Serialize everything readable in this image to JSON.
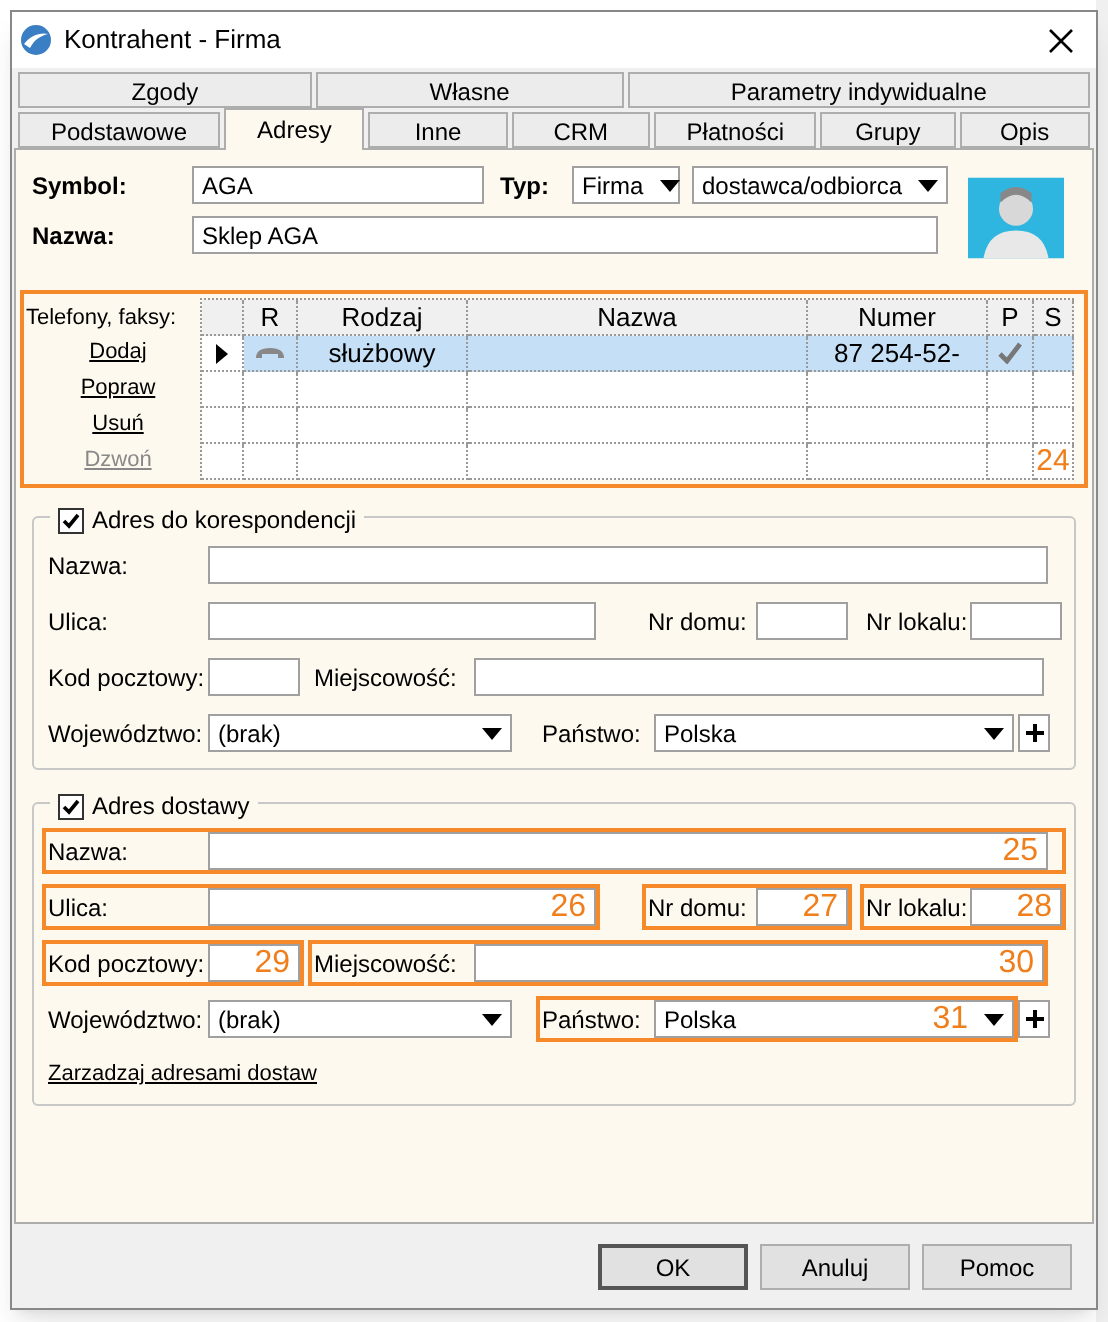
{
  "window": {
    "title": "Kontrahent - Firma"
  },
  "tabs_row_1": [
    {
      "label": "Zgody",
      "selected": false
    },
    {
      "label": "Własne",
      "selected": false
    },
    {
      "label": "Parametry indywidualne",
      "selected": false
    }
  ],
  "tabs_row_2": [
    {
      "label": "Podstawowe",
      "selected": false
    },
    {
      "label": "Adresy",
      "selected": true
    },
    {
      "label": "Inne",
      "selected": false
    },
    {
      "label": "CRM",
      "selected": false
    },
    {
      "label": "Płatności",
      "selected": false
    },
    {
      "label": "Grupy",
      "selected": false
    },
    {
      "label": "Opis",
      "selected": false
    }
  ],
  "header": {
    "symbol_label": "Symbol:",
    "symbol_value": "AGA",
    "type_label": "Typ:",
    "type_value": "Firma",
    "role_value": "dostawca/odbiorca",
    "name_label": "Nazwa:",
    "name_value": "Sklep AGA"
  },
  "phones": {
    "label": "Telefony, faksy:",
    "annotation": "24",
    "actions": [
      {
        "label": "Dodaj",
        "disabled": false
      },
      {
        "label": "Popraw",
        "disabled": false
      },
      {
        "label": "Usuń",
        "disabled": false
      },
      {
        "label": "Dzwoń",
        "disabled": true
      }
    ],
    "columns": [
      "R",
      "Rodzaj",
      "Nazwa",
      "Numer",
      "P",
      "S"
    ],
    "rows": [
      {
        "selected": true,
        "type": "służbowy",
        "number": "87 254-52-",
        "primary": true
      }
    ]
  },
  "correspondence": {
    "checked": true,
    "title": "Adres do korespondencji",
    "fields": {
      "name": {
        "label": "Nazwa:"
      },
      "street": {
        "label": "Ulica:"
      },
      "house": {
        "label": "Nr domu:"
      },
      "flat": {
        "label": "Nr lokalu:"
      },
      "postal": {
        "label": "Kod pocztowy:"
      },
      "city": {
        "label": "Miejscowość:"
      },
      "province": {
        "label": "Województwo:",
        "value": "(brak)"
      },
      "country": {
        "label": "Państwo:",
        "value": "Polska"
      }
    }
  },
  "delivery": {
    "checked": true,
    "title": "Adres dostawy",
    "fields": {
      "name": {
        "label": "Nazwa:",
        "annotation": "25"
      },
      "street": {
        "label": "Ulica:",
        "annotation": "26"
      },
      "house": {
        "label": "Nr domu:",
        "annotation": "27"
      },
      "flat": {
        "label": "Nr lokalu:",
        "annotation": "28"
      },
      "postal": {
        "label": "Kod pocztowy:",
        "annotation": "29"
      },
      "city": {
        "label": "Miejscowość:",
        "annotation": "30"
      },
      "province": {
        "label": "Województwo:",
        "value": "(brak)"
      },
      "country": {
        "label": "Państwo:",
        "value": "Polska",
        "annotation": "31"
      }
    },
    "link": "Zarzadzaj adresami dostaw"
  },
  "buttons": [
    {
      "label": "OK",
      "default": true
    },
    {
      "label": "Anuluj",
      "default": false
    },
    {
      "label": "Pomoc",
      "default": false
    }
  ]
}
